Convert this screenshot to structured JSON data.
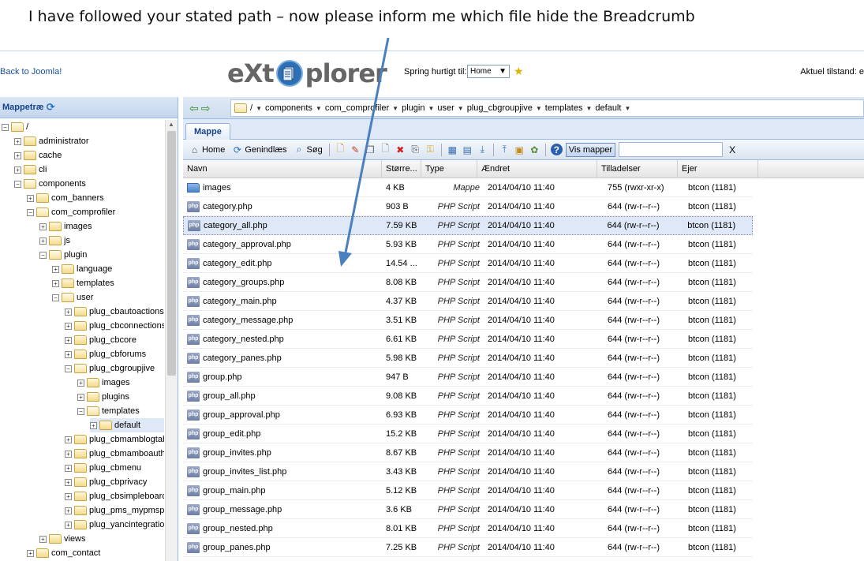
{
  "caption": "I have followed your stated path – now please inform me which file hide the Breadcrumb",
  "header": {
    "back_link": "Back to Joomla!",
    "logo_left": "eXt",
    "logo_right": "plorer",
    "jump_label": "Spring hurtigt til:",
    "jump_value": "Home",
    "status_label": "Aktuel tilstand: e"
  },
  "tree": {
    "title": "Mappetræ",
    "items": [
      {
        "label": "/",
        "depth": 0,
        "open": true
      },
      {
        "label": "administrator",
        "depth": 1,
        "open": false
      },
      {
        "label": "cache",
        "depth": 1,
        "open": false
      },
      {
        "label": "cli",
        "depth": 1,
        "open": false
      },
      {
        "label": "components",
        "depth": 1,
        "open": true
      },
      {
        "label": "com_banners",
        "depth": 2,
        "open": false
      },
      {
        "label": "com_comprofiler",
        "depth": 2,
        "open": true
      },
      {
        "label": "images",
        "depth": 3,
        "open": false
      },
      {
        "label": "js",
        "depth": 3,
        "open": false
      },
      {
        "label": "plugin",
        "depth": 3,
        "open": true
      },
      {
        "label": "language",
        "depth": 4,
        "open": false
      },
      {
        "label": "templates",
        "depth": 4,
        "open": false
      },
      {
        "label": "user",
        "depth": 4,
        "open": true
      },
      {
        "label": "plug_cbautoactions",
        "depth": 5,
        "open": false
      },
      {
        "label": "plug_cbconnections",
        "depth": 5,
        "open": false
      },
      {
        "label": "plug_cbcore",
        "depth": 5,
        "open": false
      },
      {
        "label": "plug_cbforums",
        "depth": 5,
        "open": false
      },
      {
        "label": "plug_cbgroupjive",
        "depth": 5,
        "open": true
      },
      {
        "label": "images",
        "depth": 6,
        "open": false
      },
      {
        "label": "plugins",
        "depth": 6,
        "open": false
      },
      {
        "label": "templates",
        "depth": 6,
        "open": true
      },
      {
        "label": "default",
        "depth": 7,
        "open": false,
        "selected": true
      },
      {
        "label": "plug_cbmamblogtab",
        "depth": 5,
        "open": false
      },
      {
        "label": "plug_cbmamboautho",
        "depth": 5,
        "open": false
      },
      {
        "label": "plug_cbmenu",
        "depth": 5,
        "open": false
      },
      {
        "label": "plug_cbprivacy",
        "depth": 5,
        "open": false
      },
      {
        "label": "plug_cbsimpleboardt",
        "depth": 5,
        "open": false
      },
      {
        "label": "plug_pms_mypmspro",
        "depth": 5,
        "open": false
      },
      {
        "label": "plug_yancintegration",
        "depth": 5,
        "open": false
      },
      {
        "label": "views",
        "depth": 3,
        "open": false
      },
      {
        "label": "com_contact",
        "depth": 2,
        "open": false
      }
    ]
  },
  "breadcrumb": [
    "/",
    "components",
    "com_comprofiler",
    "plugin",
    "user",
    "plug_cbgroupjive",
    "templates",
    "default"
  ],
  "tab": "Mappe",
  "toolbar": {
    "home": "Home",
    "reload": "Genindlæs",
    "search": "Søg",
    "show_dirs": "Vis mapper",
    "clear": "X"
  },
  "grid": {
    "columns": [
      "Navn",
      "Større...",
      "Type",
      "Ændret",
      "Tilladelser",
      "Ejer"
    ],
    "rows": [
      {
        "name": "images",
        "size": "4 KB",
        "type": "Mappe",
        "date": "2014/04/10 11:40",
        "perm": "755 (rwxr-xr-x)",
        "owner": "btcon (1181)",
        "kind": "dir"
      },
      {
        "name": "category.php",
        "size": "903 B",
        "type": "PHP Script",
        "date": "2014/04/10 11:40",
        "perm": "644 (rw-r--r--)",
        "owner": "btcon (1181)",
        "kind": "php"
      },
      {
        "name": "category_all.php",
        "size": "7.59 KB",
        "type": "PHP Script",
        "date": "2014/04/10 11:40",
        "perm": "644 (rw-r--r--)",
        "owner": "btcon (1181)",
        "kind": "php",
        "highlight": true
      },
      {
        "name": "category_approval.php",
        "size": "5.93 KB",
        "type": "PHP Script",
        "date": "2014/04/10 11:40",
        "perm": "644 (rw-r--r--)",
        "owner": "btcon (1181)",
        "kind": "php"
      },
      {
        "name": "category_edit.php",
        "size": "14.54 ...",
        "type": "PHP Script",
        "date": "2014/04/10 11:40",
        "perm": "644 (rw-r--r--)",
        "owner": "btcon (1181)",
        "kind": "php"
      },
      {
        "name": "category_groups.php",
        "size": "8.08 KB",
        "type": "PHP Script",
        "date": "2014/04/10 11:40",
        "perm": "644 (rw-r--r--)",
        "owner": "btcon (1181)",
        "kind": "php"
      },
      {
        "name": "category_main.php",
        "size": "4.37 KB",
        "type": "PHP Script",
        "date": "2014/04/10 11:40",
        "perm": "644 (rw-r--r--)",
        "owner": "btcon (1181)",
        "kind": "php"
      },
      {
        "name": "category_message.php",
        "size": "3.51 KB",
        "type": "PHP Script",
        "date": "2014/04/10 11:40",
        "perm": "644 (rw-r--r--)",
        "owner": "btcon (1181)",
        "kind": "php"
      },
      {
        "name": "category_nested.php",
        "size": "6.61 KB",
        "type": "PHP Script",
        "date": "2014/04/10 11:40",
        "perm": "644 (rw-r--r--)",
        "owner": "btcon (1181)",
        "kind": "php"
      },
      {
        "name": "category_panes.php",
        "size": "5.98 KB",
        "type": "PHP Script",
        "date": "2014/04/10 11:40",
        "perm": "644 (rw-r--r--)",
        "owner": "btcon (1181)",
        "kind": "php"
      },
      {
        "name": "group.php",
        "size": "947 B",
        "type": "PHP Script",
        "date": "2014/04/10 11:40",
        "perm": "644 (rw-r--r--)",
        "owner": "btcon (1181)",
        "kind": "php"
      },
      {
        "name": "group_all.php",
        "size": "9.08 KB",
        "type": "PHP Script",
        "date": "2014/04/10 11:40",
        "perm": "644 (rw-r--r--)",
        "owner": "btcon (1181)",
        "kind": "php"
      },
      {
        "name": "group_approval.php",
        "size": "6.93 KB",
        "type": "PHP Script",
        "date": "2014/04/10 11:40",
        "perm": "644 (rw-r--r--)",
        "owner": "btcon (1181)",
        "kind": "php"
      },
      {
        "name": "group_edit.php",
        "size": "15.2 KB",
        "type": "PHP Script",
        "date": "2014/04/10 11:40",
        "perm": "644 (rw-r--r--)",
        "owner": "btcon (1181)",
        "kind": "php"
      },
      {
        "name": "group_invites.php",
        "size": "8.67 KB",
        "type": "PHP Script",
        "date": "2014/04/10 11:40",
        "perm": "644 (rw-r--r--)",
        "owner": "btcon (1181)",
        "kind": "php"
      },
      {
        "name": "group_invites_list.php",
        "size": "3.43 KB",
        "type": "PHP Script",
        "date": "2014/04/10 11:40",
        "perm": "644 (rw-r--r--)",
        "owner": "btcon (1181)",
        "kind": "php"
      },
      {
        "name": "group_main.php",
        "size": "5.12 KB",
        "type": "PHP Script",
        "date": "2014/04/10 11:40",
        "perm": "644 (rw-r--r--)",
        "owner": "btcon (1181)",
        "kind": "php"
      },
      {
        "name": "group_message.php",
        "size": "3.6 KB",
        "type": "PHP Script",
        "date": "2014/04/10 11:40",
        "perm": "644 (rw-r--r--)",
        "owner": "btcon (1181)",
        "kind": "php"
      },
      {
        "name": "group_nested.php",
        "size": "8.01 KB",
        "type": "PHP Script",
        "date": "2014/04/10 11:40",
        "perm": "644 (rw-r--r--)",
        "owner": "btcon (1181)",
        "kind": "php"
      },
      {
        "name": "group_panes.php",
        "size": "7.25 KB",
        "type": "PHP Script",
        "date": "2014/04/10 11:40",
        "perm": "644 (rw-r--r--)",
        "owner": "btcon (1181)",
        "kind": "php"
      }
    ]
  },
  "colors": {
    "accent": "#15428b",
    "arrow": "#4a7fc0",
    "selection": "#dfe8f6"
  }
}
